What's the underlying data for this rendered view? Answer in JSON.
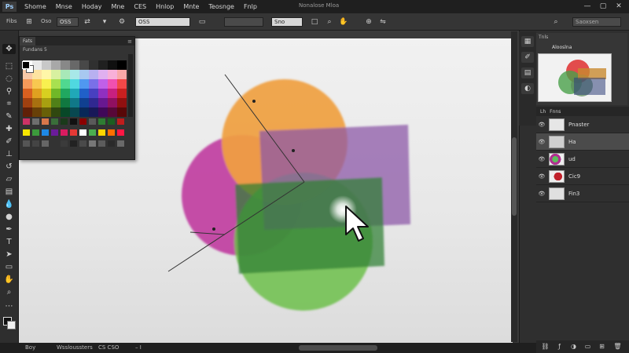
{
  "menubar": {
    "logo": "Ps",
    "items": [
      "Shome",
      "Mnse",
      "Hoday",
      "Mne",
      "CES",
      "Hnlop",
      "Mnte",
      "Teosnge",
      "Fnlp"
    ],
    "title": "Nonalose Mloa",
    "controls": [
      "—",
      "▢",
      "✕"
    ]
  },
  "options": {
    "label1": "Fibs",
    "label2": "Oso",
    "field1": "OSS",
    "field2": "OSS",
    "field3": "",
    "field4": "Sno",
    "search_placeholder": "Saoxsen"
  },
  "swatches": {
    "tab": "Fats",
    "subtitle": "Fundans 5",
    "grid_colors": [
      "#ffffff",
      "#e8e8e8",
      "#c8c8c8",
      "#a8a8a8",
      "#888888",
      "#686868",
      "#484848",
      "#303030",
      "#202020",
      "#101010",
      "#000000",
      "#f9c9a8",
      "#fde3a0",
      "#fff6a8",
      "#d8f0a0",
      "#a8e8b8",
      "#a8e8e8",
      "#a8c8f0",
      "#b8b0f0",
      "#e0b0f0",
      "#f8b0d8",
      "#f8a8a8",
      "#f59a5a",
      "#f8c850",
      "#f8f050",
      "#a8e050",
      "#50d890",
      "#50d8e0",
      "#5098f0",
      "#7a70e8",
      "#c060e8",
      "#f050b0",
      "#f04848",
      "#d86020",
      "#e0a020",
      "#d8d020",
      "#70b828",
      "#20a860",
      "#20a8b8",
      "#2060c8",
      "#4840c0",
      "#9030c0",
      "#c82080",
      "#c82020",
      "#a04010",
      "#a87010",
      "#a8a010",
      "#508018",
      "#107840",
      "#107888",
      "#104090",
      "#302890",
      "#681890",
      "#901060",
      "#901010",
      "#602008",
      "#684008",
      "#686008",
      "#304810",
      "#084828",
      "#084850",
      "#082858",
      "#181858",
      "#400858",
      "#580838",
      "#580808"
    ],
    "row1": [
      "#cc3366",
      "#6e6e6e",
      "#d9774a",
      "#3a6e3a",
      "#1a3a1a",
      "#111111",
      "#8b0000",
      "#5a5a5a",
      "#2e7d32",
      "#1b5e20",
      "#bf1d1d"
    ],
    "row2": [
      "#f7e600",
      "#3c9a3c",
      "#1e88e5",
      "#6a1b9a",
      "#d81b60",
      "#e53935",
      "#ffffff",
      "#4caf50",
      "#ffd600",
      "#ff6f00",
      "#ff1744"
    ],
    "row3": [
      "#555555",
      "#444444",
      "#666666",
      "#333333",
      "#3b3b3b",
      "#222222",
      "#4a4a4a",
      "#777777",
      "#5c5c5c",
      "#2a2a2a",
      "#6a6a6a"
    ]
  },
  "navigator": {
    "tab": "Tnls",
    "subtitle": "Alooslna"
  },
  "layers": {
    "tabs": [
      "Lh",
      "Fnns"
    ],
    "items": [
      {
        "name": "Pnaster",
        "visible": true,
        "selected": false
      },
      {
        "name": "Ha",
        "visible": true,
        "selected": true
      },
      {
        "name": "ud",
        "visible": true,
        "selected": false
      },
      {
        "name": "Cic9",
        "visible": true,
        "selected": false
      },
      {
        "name": "Fin3",
        "visible": true,
        "selected": false
      }
    ]
  },
  "status": {
    "zoom": "Boy",
    "doc": "Wssloussters",
    "info": "CS CSO",
    "extra": "–  I"
  },
  "canvas": {
    "shapes": {
      "orange": "#f0a040",
      "magenta": "#c03aa0",
      "green": "#6cc04a",
      "purple": "#8e58a8",
      "dark_green": "#2f7f35"
    }
  }
}
